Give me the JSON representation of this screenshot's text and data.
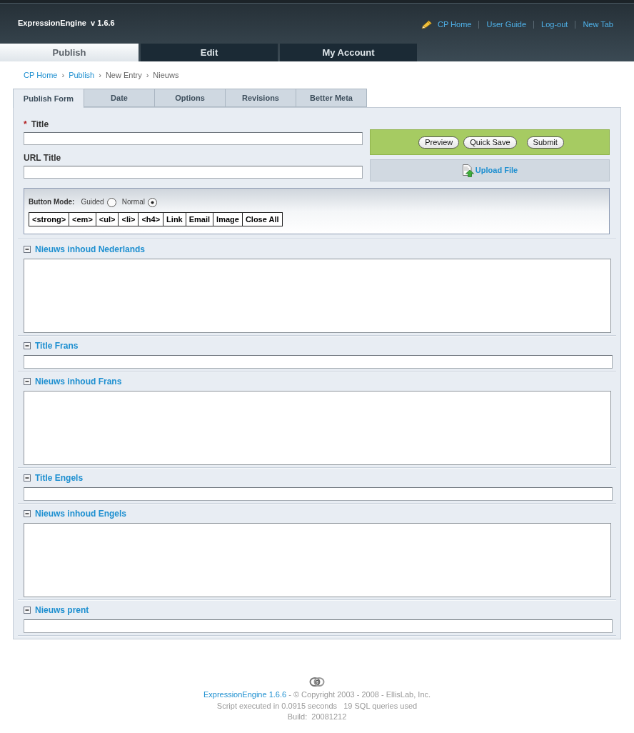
{
  "header": {
    "title": "ExpressionEngine  v 1.6.6",
    "links": [
      "CP Home",
      "User Guide",
      "Log-out",
      "New Tab"
    ]
  },
  "main_tabs": [
    {
      "label": "Publish",
      "selected": true
    },
    {
      "label": "Edit",
      "selected": false
    },
    {
      "label": "My Account",
      "selected": false
    }
  ],
  "breadcrumb": {
    "separator": "›",
    "items": [
      {
        "label": "CP Home",
        "kind": "link"
      },
      {
        "label": "Publish",
        "kind": "link"
      },
      {
        "label": "New Entry",
        "kind": "text"
      },
      {
        "label": "Nieuws",
        "kind": "text"
      }
    ]
  },
  "publish_tabs": [
    {
      "label": "Publish Form",
      "selected": true
    },
    {
      "label": "Date",
      "selected": false
    },
    {
      "label": "Options",
      "selected": false
    },
    {
      "label": "Revisions",
      "selected": false
    },
    {
      "label": "Better Meta",
      "selected": false
    }
  ],
  "form": {
    "title_fields": [
      {
        "label": "Title",
        "required_mark": "*"
      },
      {
        "label": "URL Title"
      }
    ],
    "actions": [
      "Preview",
      "Quick Save",
      "Submit"
    ],
    "upload": "Upload File",
    "button_mode": {
      "label": "Button Mode:",
      "options": [
        {
          "label": "Guided",
          "selected": false
        },
        {
          "label": "Normal",
          "selected": true
        }
      ]
    },
    "format_buttons": [
      "<strong>",
      "<em>",
      "<ul>",
      "<li>",
      "<h4>",
      "Link",
      "Email",
      "Image",
      "Close All"
    ]
  },
  "fields": [
    {
      "label": "Nieuws inhoud Nederlands",
      "kind": "textarea",
      "expanded": true
    },
    {
      "label": "Title Frans",
      "kind": "text",
      "expanded": true
    },
    {
      "label": "Nieuws inhoud Frans",
      "kind": "textarea",
      "expanded": true
    },
    {
      "label": "Title Engels",
      "kind": "text",
      "expanded": true
    },
    {
      "label": "Nieuws inhoud Engels",
      "kind": "textarea",
      "expanded": true
    },
    {
      "label": "Nieuws prent",
      "kind": "text",
      "expanded": true
    }
  ],
  "footer": {
    "product_link": "ExpressionEngine 1.6.6",
    "copyright": "- © Copyright 2003 - 2008 - EllisLab, Inc.",
    "stats": "Script executed in 0.0915 seconds   19 SQL queries used",
    "build": "Build:  20081212"
  }
}
